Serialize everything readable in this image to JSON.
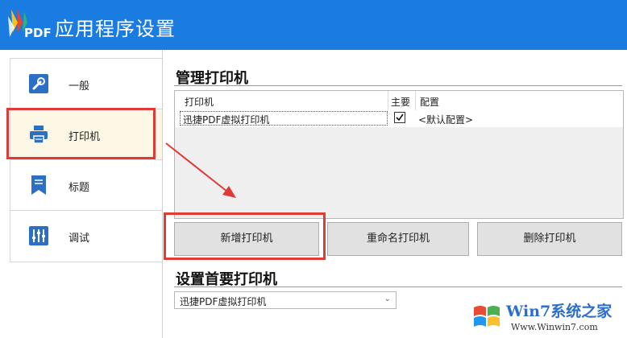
{
  "app": {
    "title": "应用程序设置",
    "logo_text": "PDF"
  },
  "sidebar": {
    "items": [
      {
        "label": "一般",
        "icon": "wrench-icon"
      },
      {
        "label": "打印机",
        "icon": "printer-icon"
      },
      {
        "label": "标题",
        "icon": "bookmark-icon"
      },
      {
        "label": "调试",
        "icon": "sliders-icon"
      }
    ],
    "active_index": 1
  },
  "manage": {
    "heading": "管理打印机",
    "columns": [
      "打印机",
      "主要",
      "配置"
    ],
    "rows": [
      {
        "printer": "迅捷PDF虚拟打印机",
        "primary": true,
        "config": "<默认配置>"
      }
    ]
  },
  "buttons": {
    "add": "新增打印机",
    "rename": "重命名打印机",
    "delete": "删除打印机"
  },
  "primary": {
    "heading": "设置首要打印机",
    "selected": "迅捷PDF虚拟打印机"
  },
  "watermark": {
    "brand": "Win7系统之家",
    "url": "Www.Winwin7.com"
  },
  "colors": {
    "header": "#1a7be0",
    "highlight": "#e03a36",
    "active_bg": "#fdf7e6"
  }
}
